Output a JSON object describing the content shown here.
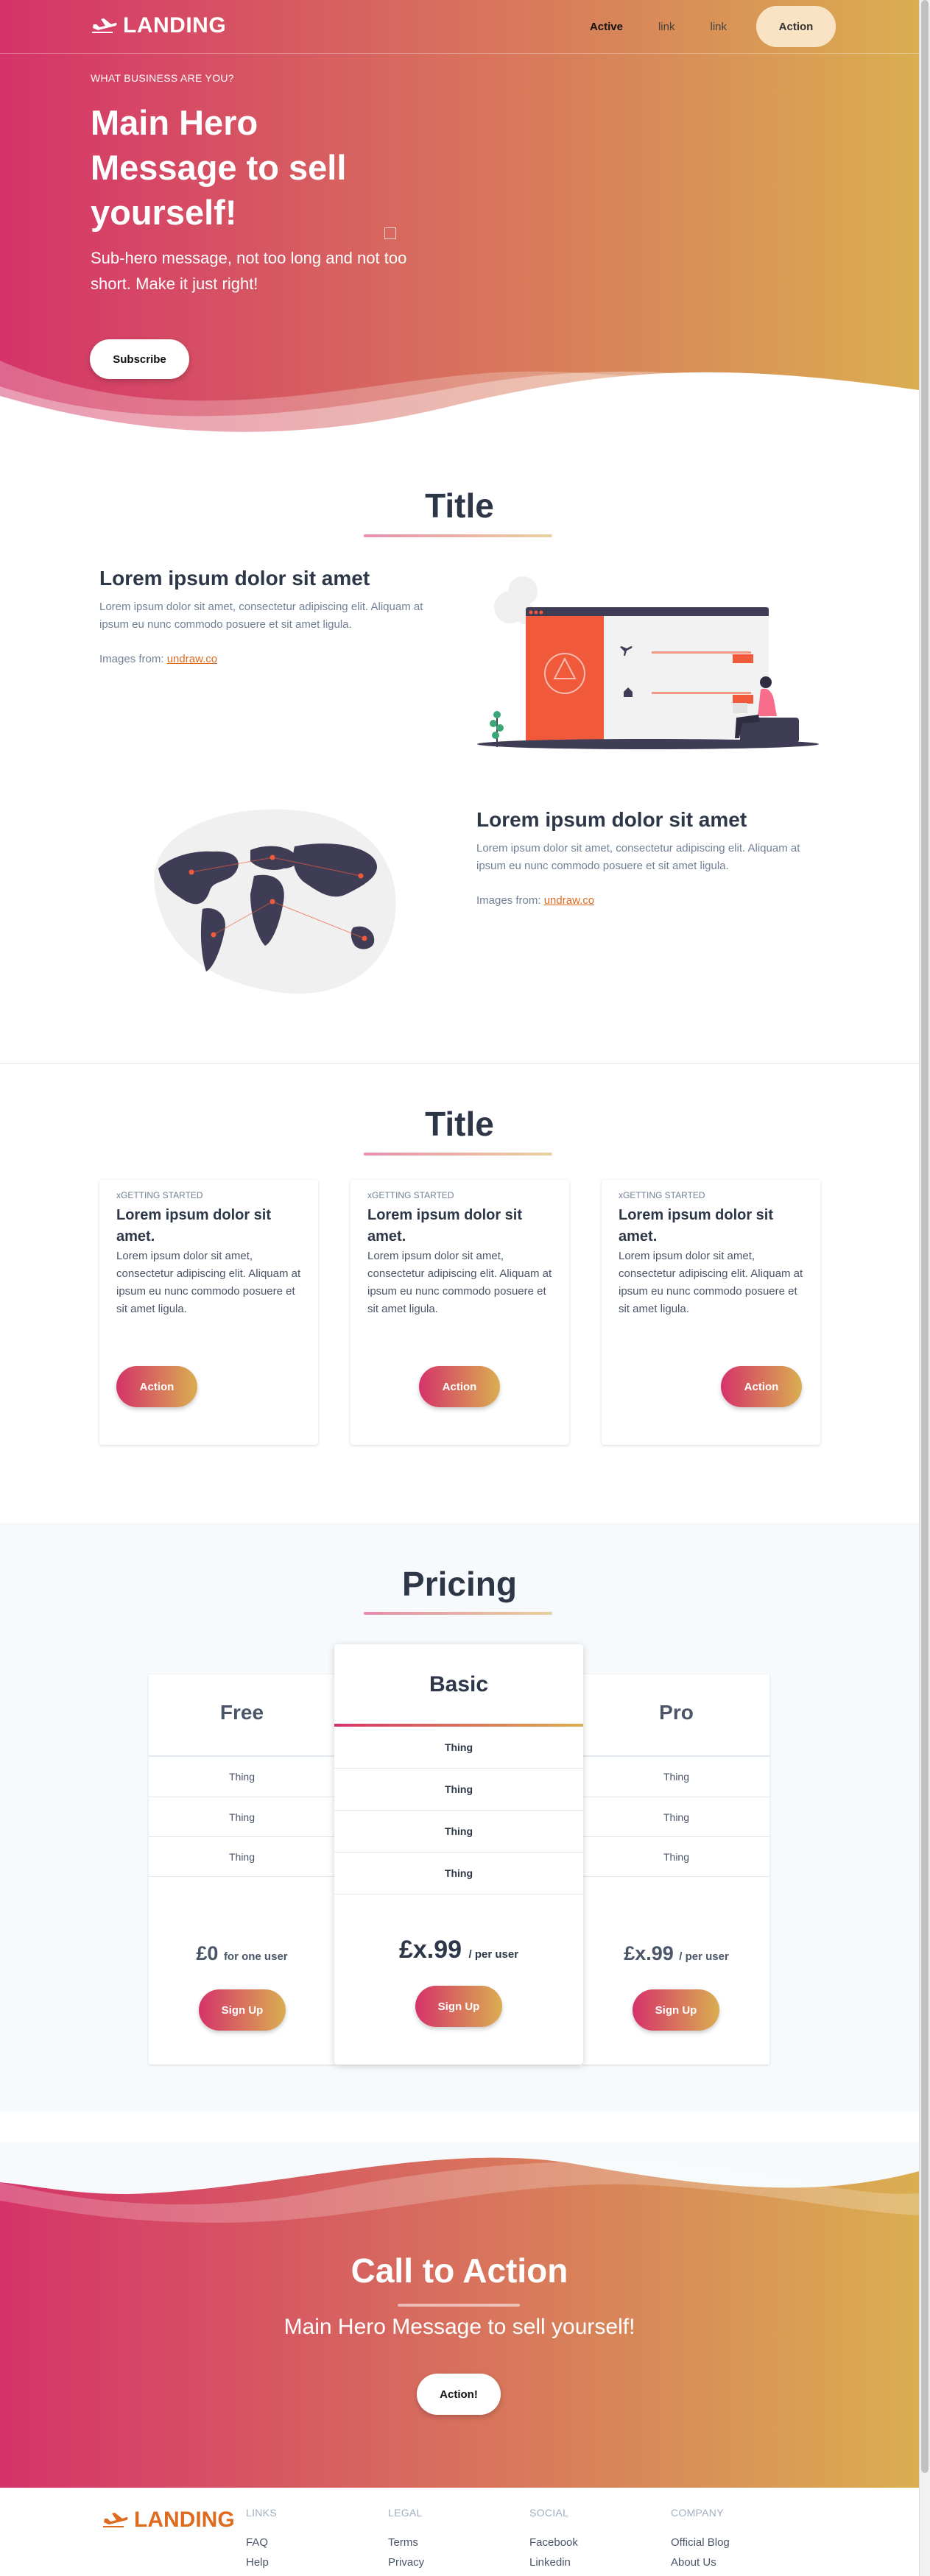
{
  "nav": {
    "brand": "LANDING",
    "links": [
      {
        "label": "Active"
      },
      {
        "label": "link"
      },
      {
        "label": "link"
      }
    ],
    "action_label": "Action"
  },
  "hero": {
    "eyebrow": "WHAT BUSINESS ARE YOU?",
    "title": "Main Hero Message to sell yourself!",
    "subtitle": "Sub-hero message, not too long and not too short. Make it just right!",
    "subscribe_label": "Subscribe"
  },
  "features": {
    "title": "Title",
    "items": [
      {
        "heading": "Lorem ipsum dolor sit amet",
        "body": "Lorem ipsum dolor sit amet, consectetur adipiscing elit. Aliquam at ipsum eu nunc commodo posuere et sit amet ligula.",
        "source_prefix": "Images from: ",
        "source_link": "undraw.co"
      },
      {
        "heading": "Lorem ipsum dolor sit amet",
        "body": "Lorem ipsum dolor sit amet, consectetur adipiscing elit. Aliquam at ipsum eu nunc commodo posuere et sit amet ligula.",
        "source_prefix": "Images from: ",
        "source_link": "undraw.co"
      }
    ]
  },
  "cards": {
    "title": "Title",
    "items": [
      {
        "eyebrow": "xGETTING STARTED",
        "heading": "Lorem ipsum dolor sit amet.",
        "body": "Lorem ipsum dolor sit amet, consectetur adipiscing elit. Aliquam at ipsum eu nunc commodo posuere et sit amet ligula.",
        "action": "Action"
      },
      {
        "eyebrow": "xGETTING STARTED",
        "heading": "Lorem ipsum dolor sit amet.",
        "body": "Lorem ipsum dolor sit amet, consectetur adipiscing elit. Aliquam at ipsum eu nunc commodo posuere et sit amet ligula.",
        "action": "Action"
      },
      {
        "eyebrow": "xGETTING STARTED",
        "heading": "Lorem ipsum dolor sit amet.",
        "body": "Lorem ipsum dolor sit amet, consectetur adipiscing elit. Aliquam at ipsum eu nunc commodo posuere et sit amet ligula.",
        "action": "Action"
      }
    ]
  },
  "pricing": {
    "title": "Pricing",
    "plans": [
      {
        "name": "Free",
        "features": [
          "Thing",
          "Thing",
          "Thing"
        ],
        "price": "£0",
        "per": "for one user",
        "cta": "Sign Up"
      },
      {
        "name": "Basic",
        "features": [
          "Thing",
          "Thing",
          "Thing",
          "Thing"
        ],
        "price": "£x.99",
        "per": "/ per user",
        "cta": "Sign Up"
      },
      {
        "name": "Pro",
        "features": [
          "Thing",
          "Thing",
          "Thing"
        ],
        "price": "£x.99",
        "per": "/ per user",
        "cta": "Sign Up"
      }
    ]
  },
  "cta": {
    "title": "Call to Action",
    "subtitle": "Main Hero Message to sell yourself!",
    "button": "Action!"
  },
  "footer": {
    "brand": "LANDING",
    "columns": [
      {
        "heading": "LINKS",
        "links": [
          "FAQ",
          "Help"
        ]
      },
      {
        "heading": "LEGAL",
        "links": [
          "Terms",
          "Privacy"
        ]
      },
      {
        "heading": "SOCIAL",
        "links": [
          "Facebook",
          "Linkedin"
        ]
      },
      {
        "heading": "COMPANY",
        "links": [
          "Official Blog",
          "About Us"
        ]
      }
    ]
  },
  "colors": {
    "gradient_start": "#d53369",
    "gradient_end": "#daae51",
    "accent": "#dd6b20",
    "text_dark": "#2d3748",
    "illustration_red": "#f05a3b"
  }
}
